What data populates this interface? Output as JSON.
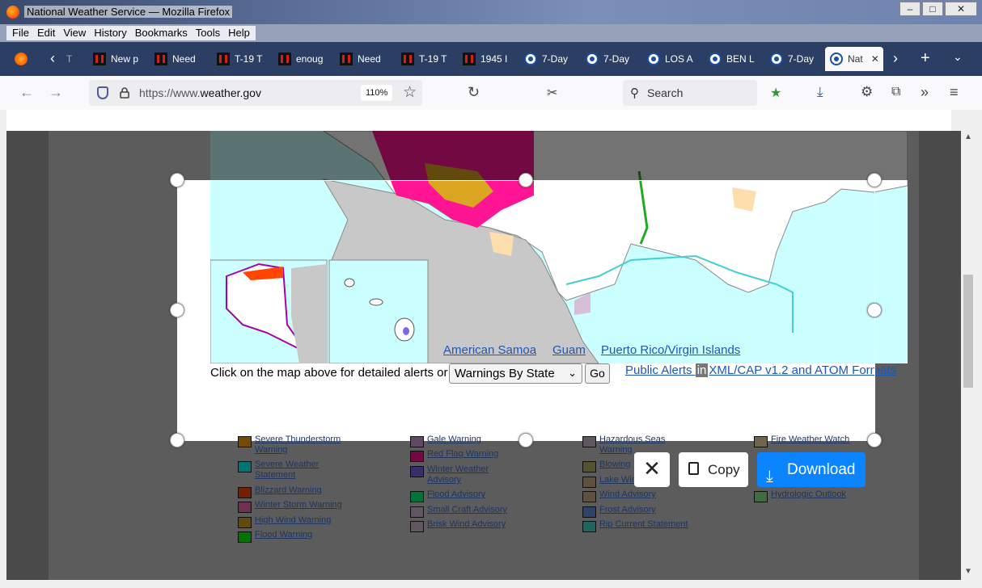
{
  "window": {
    "title": "National Weather Service — Mozilla Firefox",
    "minimize": "–",
    "maximize": "□",
    "close": "✕"
  },
  "menu": [
    "File",
    "Edit",
    "View",
    "History",
    "Bookmarks",
    "Tools",
    "Help"
  ],
  "tabs": [
    {
      "label": "T",
      "favicon": "ih"
    },
    {
      "label": "New p",
      "favicon": "ih"
    },
    {
      "label": "Need",
      "favicon": "ih"
    },
    {
      "label": "T-19 T",
      "favicon": "ih"
    },
    {
      "label": "enoug",
      "favicon": "ih"
    },
    {
      "label": "Need",
      "favicon": "ih"
    },
    {
      "label": "T-19 T",
      "favicon": "ih"
    },
    {
      "label": "1945 I",
      "favicon": "ih"
    },
    {
      "label": "7-Day",
      "favicon": "nws"
    },
    {
      "label": "7-Day",
      "favicon": "nws"
    },
    {
      "label": "LOS A",
      "favicon": "nws"
    },
    {
      "label": "BEN L",
      "favicon": "nws"
    },
    {
      "label": "7-Day",
      "favicon": "nws"
    },
    {
      "label": "Nat",
      "favicon": "nws",
      "active": true
    }
  ],
  "tab_close": "✕",
  "nav": {
    "url_prefix": "https://www.",
    "url_host": "weather.gov",
    "zoom": "110%",
    "search_placeholder": "Search"
  },
  "territories": [
    "American Samoa",
    "Guam",
    "Puerto Rico/Virgin Islands"
  ],
  "controls": {
    "click_text": "Click on the map above for detailed alerts or",
    "select_value": "Warnings By State",
    "go_label": "Go",
    "public_alerts": "Public Alerts",
    "in_badge": "in",
    "formats": "XML/CAP v1.2 and ATOM Formats"
  },
  "legend": [
    {
      "label": "Severe Thunderstorm Warning",
      "color": "#ffa500"
    },
    {
      "label": "Severe Weather Statement",
      "color": "#00ffff"
    },
    {
      "label": "Blizzard Warning",
      "color": "#ff4500"
    },
    {
      "label": "Winter Storm Warning",
      "color": "#ff69b4"
    },
    {
      "label": "High Wind Warning",
      "color": "#daa520"
    },
    {
      "label": "Flood Warning",
      "color": "#00ff00"
    },
    {
      "label": "Gale Warning",
      "color": "#dda0dd"
    },
    {
      "label": "Red Flag Warning",
      "color": "#ff1493"
    },
    {
      "label": "Winter Weather Advisory",
      "color": "#7b68ee"
    },
    {
      "label": "Flood Advisory",
      "color": "#00ff7f"
    },
    {
      "label": "Small Craft Advisory",
      "color": "#d8bfd8"
    },
    {
      "label": "Brisk Wind Advisory",
      "color": "#d8bfd8"
    },
    {
      "label": "Hazardous Seas Warning",
      "color": "#d8bfd8"
    },
    {
      "label": "Blowing",
      "color": "#bdb76b"
    },
    {
      "label": "Lake Win",
      "color": "#d2b48c"
    },
    {
      "label": "Wind Advisory",
      "color": "#d2b48c"
    },
    {
      "label": "Frost Advisory",
      "color": "#6495ed"
    },
    {
      "label": "Rip Current Statement",
      "color": "#40e0d0"
    },
    {
      "label": "Fire Weather Watch",
      "color": "#ffdead"
    },
    {
      "label": "Hydrologic Outlook",
      "color": "#90ee90"
    }
  ],
  "screenshot_toolbar": {
    "close": "✕",
    "copy": "Copy",
    "download": "Download"
  },
  "colors": {
    "ocean": "#ccffff",
    "land": "#ffffff",
    "mexico": "#c8c8c8",
    "red_flag": "#ff1493",
    "high_wind": "#daa520",
    "fire_weather": "#ffdead",
    "accent": "#0a84ff"
  }
}
